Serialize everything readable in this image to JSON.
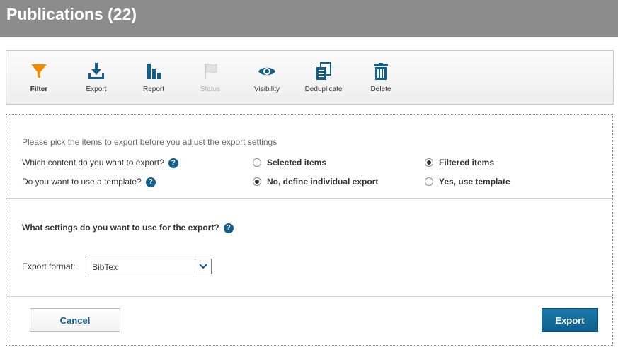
{
  "header": {
    "title": "Publications (22)"
  },
  "toolbar": {
    "items": [
      {
        "label": "Filter",
        "icon": "filter-icon",
        "color": "#f08a00",
        "state": "active"
      },
      {
        "label": "Export",
        "icon": "download-icon",
        "color": "#125e8c",
        "state": "normal"
      },
      {
        "label": "Report",
        "icon": "bar-chart-icon",
        "color": "#125e8c",
        "state": "normal"
      },
      {
        "label": "Status",
        "icon": "flag-icon",
        "color": "#cfcfcf",
        "state": "disabled"
      },
      {
        "label": "Visibility",
        "icon": "eye-icon",
        "color": "#125e8c",
        "state": "normal"
      },
      {
        "label": "Deduplicate",
        "icon": "copy-docs-icon",
        "color": "#125e8c",
        "state": "normal"
      },
      {
        "label": "Delete",
        "icon": "trash-icon",
        "color": "#125e8c",
        "state": "normal"
      }
    ]
  },
  "export": {
    "hint": "Please pick the items to export before you adjust the export settings",
    "content_question": "Which content do you want to export?",
    "content_options": [
      {
        "label": "Selected items",
        "checked": false
      },
      {
        "label": "Filtered items",
        "checked": true
      }
    ],
    "template_question": "Do you want to use a template?",
    "template_options": [
      {
        "label": "No, define individual export",
        "checked": true
      },
      {
        "label": "Yes, use template",
        "checked": false
      }
    ],
    "settings_title": "What settings do you want to use for the export?",
    "format_label": "Export format:",
    "format_value": "BibTex",
    "help_glyph": "?"
  },
  "actions": {
    "cancel_label": "Cancel",
    "export_label": "Export"
  },
  "colors": {
    "accent": "#125e8c",
    "filter_accent": "#f08a00",
    "header_bg": "#8c8c8c"
  }
}
